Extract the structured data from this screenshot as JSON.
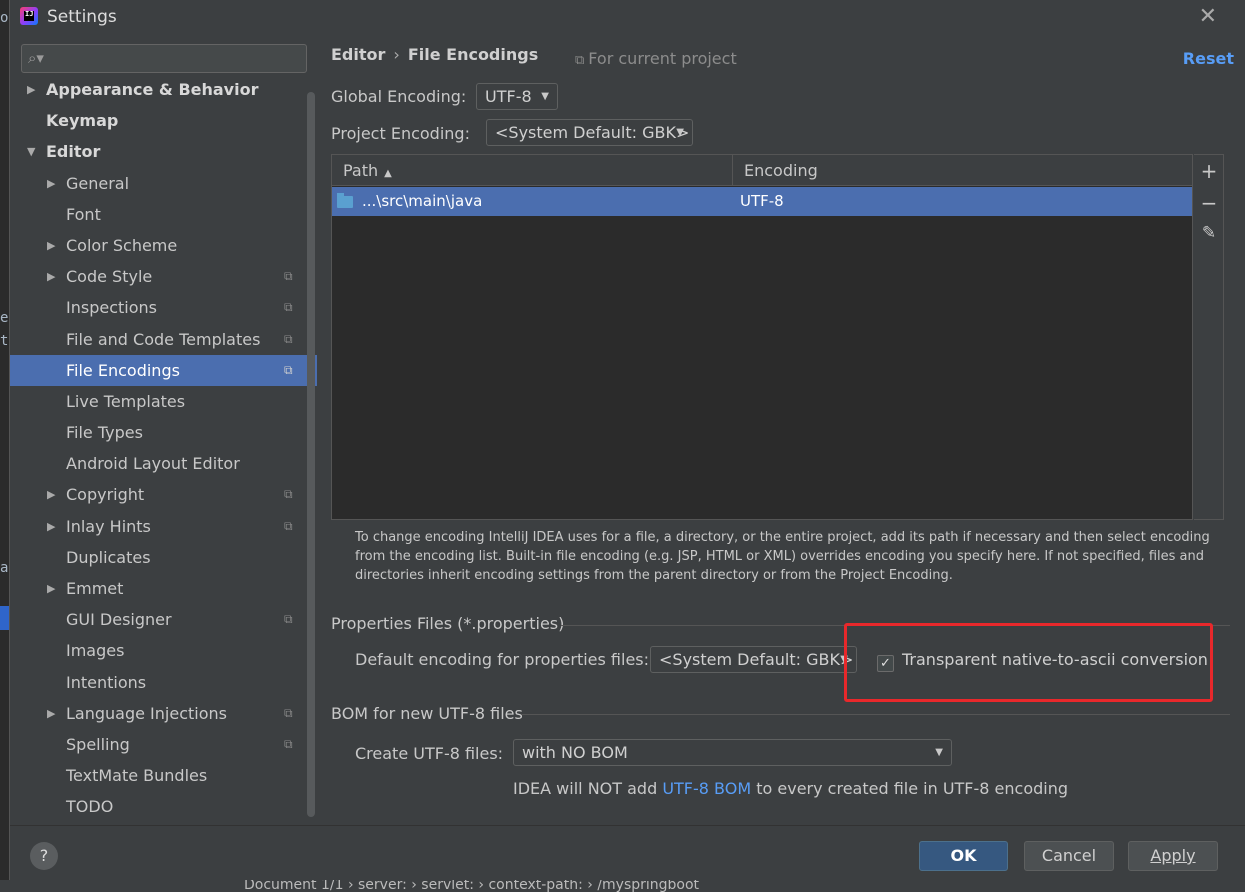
{
  "window": {
    "title": "Settings"
  },
  "sidebar": {
    "search_placeholder": "",
    "items": [
      {
        "label": "Appearance & Behavior",
        "level": 0,
        "arrow": "right",
        "bold": true,
        "copy": false
      },
      {
        "label": "Keymap",
        "level": 0,
        "arrow": "",
        "bold": true,
        "copy": false
      },
      {
        "label": "Editor",
        "level": 0,
        "arrow": "down",
        "bold": true,
        "copy": false
      },
      {
        "label": "General",
        "level": 1,
        "arrow": "right",
        "bold": false,
        "copy": false
      },
      {
        "label": "Font",
        "level": 1,
        "arrow": "",
        "bold": false,
        "copy": false
      },
      {
        "label": "Color Scheme",
        "level": 1,
        "arrow": "right",
        "bold": false,
        "copy": false
      },
      {
        "label": "Code Style",
        "level": 1,
        "arrow": "right",
        "bold": false,
        "copy": true
      },
      {
        "label": "Inspections",
        "level": 1,
        "arrow": "",
        "bold": false,
        "copy": true
      },
      {
        "label": "File and Code Templates",
        "level": 1,
        "arrow": "",
        "bold": false,
        "copy": true
      },
      {
        "label": "File Encodings",
        "level": 1,
        "arrow": "",
        "bold": false,
        "copy": true,
        "selected": true
      },
      {
        "label": "Live Templates",
        "level": 1,
        "arrow": "",
        "bold": false,
        "copy": false
      },
      {
        "label": "File Types",
        "level": 1,
        "arrow": "",
        "bold": false,
        "copy": false
      },
      {
        "label": "Android Layout Editor",
        "level": 1,
        "arrow": "",
        "bold": false,
        "copy": false
      },
      {
        "label": "Copyright",
        "level": 1,
        "arrow": "right",
        "bold": false,
        "copy": true
      },
      {
        "label": "Inlay Hints",
        "level": 1,
        "arrow": "right",
        "bold": false,
        "copy": true
      },
      {
        "label": "Duplicates",
        "level": 1,
        "arrow": "",
        "bold": false,
        "copy": false
      },
      {
        "label": "Emmet",
        "level": 1,
        "arrow": "right",
        "bold": false,
        "copy": false
      },
      {
        "label": "GUI Designer",
        "level": 1,
        "arrow": "",
        "bold": false,
        "copy": true
      },
      {
        "label": "Images",
        "level": 1,
        "arrow": "",
        "bold": false,
        "copy": false
      },
      {
        "label": "Intentions",
        "level": 1,
        "arrow": "",
        "bold": false,
        "copy": false
      },
      {
        "label": "Language Injections",
        "level": 1,
        "arrow": "right",
        "bold": false,
        "copy": true
      },
      {
        "label": "Spelling",
        "level": 1,
        "arrow": "",
        "bold": false,
        "copy": true
      },
      {
        "label": "TextMate Bundles",
        "level": 1,
        "arrow": "",
        "bold": false,
        "copy": false
      },
      {
        "label": "TODO",
        "level": 1,
        "arrow": "",
        "bold": false,
        "copy": false
      }
    ]
  },
  "header": {
    "breadcrumb_1": "Editor",
    "breadcrumb_sep": "›",
    "breadcrumb_2": "File Encodings",
    "scope": "For current project",
    "reset": "Reset"
  },
  "global_encoding": {
    "label": "Global Encoding:",
    "value": "UTF-8"
  },
  "project_encoding": {
    "label": "Project Encoding:",
    "value": "<System Default: GBK>"
  },
  "table": {
    "col_path": "Path",
    "col_encoding": "Encoding",
    "rows": [
      {
        "path": "...\\src\\main\\java",
        "encoding": "UTF-8"
      }
    ],
    "tools": {
      "add": "+",
      "remove": "−",
      "edit": "✎"
    }
  },
  "help_text": "To change encoding IntelliJ IDEA uses for a file, a directory, or the entire project, add its path if necessary and then select encoding from the encoding list. Built-in file encoding (e.g. JSP, HTML or XML) overrides encoding you specify here. If not specified, files and directories inherit encoding settings from the parent directory or from the Project Encoding.",
  "properties": {
    "section": "Properties Files (*.properties)",
    "label": "Default encoding for properties files:",
    "value": "<System Default: GBK>",
    "checkbox_label": "Transparent native-to-ascii conversion",
    "checkbox_checked": true
  },
  "bom": {
    "section": "BOM for new UTF-8 files",
    "label": "Create UTF-8 files:",
    "value": "with NO BOM",
    "note_prefix": "IDEA will NOT add ",
    "note_link": "UTF-8 BOM",
    "note_suffix": " to every created file in UTF-8 encoding"
  },
  "footer": {
    "help": "?",
    "ok": "OK",
    "cancel": "Cancel",
    "apply": "Apply"
  },
  "backdrop": {
    "status_path": "Document 1/1  ›  server:  ›  servlet:  ›  context-path:  ›  /myspringboot"
  },
  "colors": {
    "accent": "#4b6eaf",
    "link": "#589df6",
    "highlight": "#e8282b",
    "primary_button": "#365880"
  }
}
